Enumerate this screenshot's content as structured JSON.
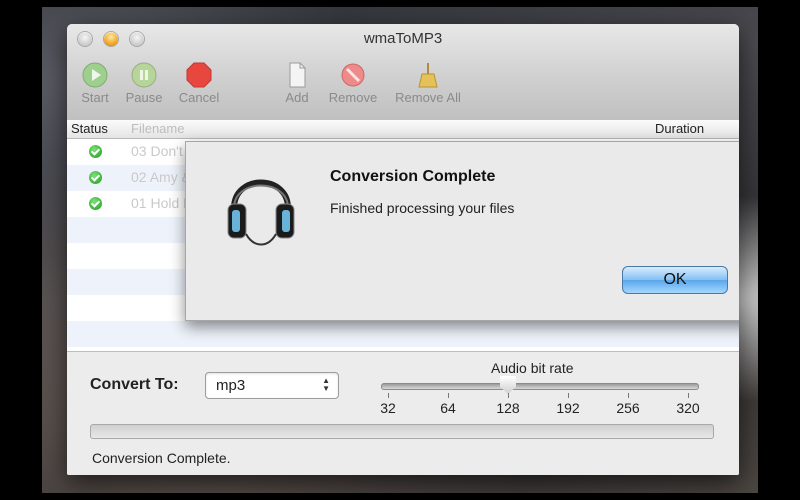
{
  "window": {
    "title": "wmaToMP3"
  },
  "toolbar": {
    "start": "Start",
    "pause": "Pause",
    "cancel": "Cancel",
    "add": "Add",
    "remove": "Remove",
    "remove_all": "Remove All"
  },
  "table": {
    "headers": {
      "status": "Status",
      "filename": "Filename",
      "duration": "Duration"
    },
    "rows": [
      {
        "file": "03 Don't Drink.wma",
        "status": "done"
      },
      {
        "file": "02 Amy & Tom.wma",
        "status": "done"
      },
      {
        "file": "01 Hold Me.mp3",
        "status": "done"
      }
    ]
  },
  "bottom": {
    "convert_label": "Convert To:",
    "format_value": "mp3",
    "bitrate_label": "Audio bit rate",
    "bitrate_ticks": [
      "32",
      "64",
      "128",
      "192",
      "256",
      "320"
    ],
    "bitrate_selected": "128",
    "progress_fraction": 0,
    "status_text": "Conversion Complete."
  },
  "dialog": {
    "title": "Conversion Complete",
    "message": "Finished processing your files",
    "ok": "OK"
  },
  "icons": {
    "start": "play-icon",
    "pause": "pause-icon",
    "cancel": "stop-icon",
    "add": "document-add-icon",
    "remove": "remove-icon",
    "remove_all": "broom-icon",
    "dialog": "headphones-icon",
    "row_status": "checkmark-icon"
  },
  "colors": {
    "ok_accent": "#5aa7ec",
    "check_green": "#1c9a1a",
    "stop_red": "#e8473f"
  }
}
